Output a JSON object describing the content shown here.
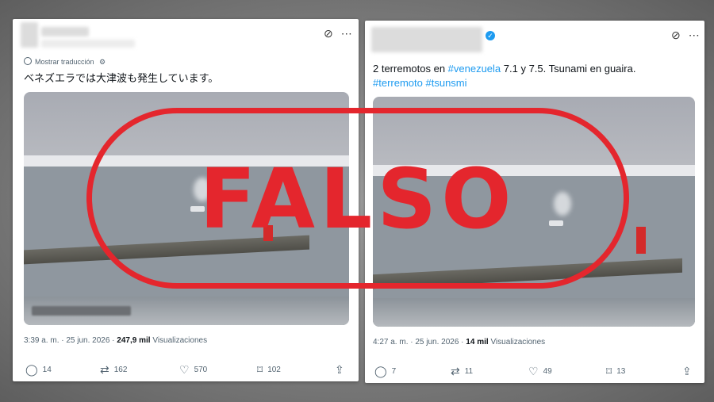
{
  "post1": {
    "translate_label": "Mostrar traducción",
    "text": "ベネズエラでは大津波も発生しています。",
    "timestamp": "3:39 a. m. · 25 jun. 2026 · ",
    "views_count": "247,9 mil",
    "views_label": "Visualizaciones",
    "actions": {
      "replies": "14",
      "reposts": "162",
      "likes": "570",
      "bookmarks": "102"
    }
  },
  "post2": {
    "text_a": "2 terremotos en ",
    "hashtag_venezuela": "#venezuela",
    "text_b": " 7.1 y 7.5. Tsunami en guaira.",
    "hashtag_terremoto": "#terremoto",
    "hashtag_tsunsmi": "#tsunsmi",
    "timestamp": "4:27 a. m. · 25 jun. 2026 · ",
    "views_count": "14 mil",
    "views_label": "Visualizaciones",
    "actions": {
      "replies": "7",
      "reposts": "11",
      "likes": "49",
      "bookmarks": "13"
    }
  },
  "stamp": {
    "label": "FALSO"
  },
  "colors": {
    "stamp": "#e4262d",
    "link": "#1d9bf0",
    "verified": "#1d9bf0"
  },
  "icons": [
    "grok-icon",
    "more-icon",
    "translate-icon",
    "settings-icon",
    "reply-icon",
    "repost-icon",
    "like-icon",
    "bookmark-icon",
    "share-icon",
    "verified-icon"
  ]
}
